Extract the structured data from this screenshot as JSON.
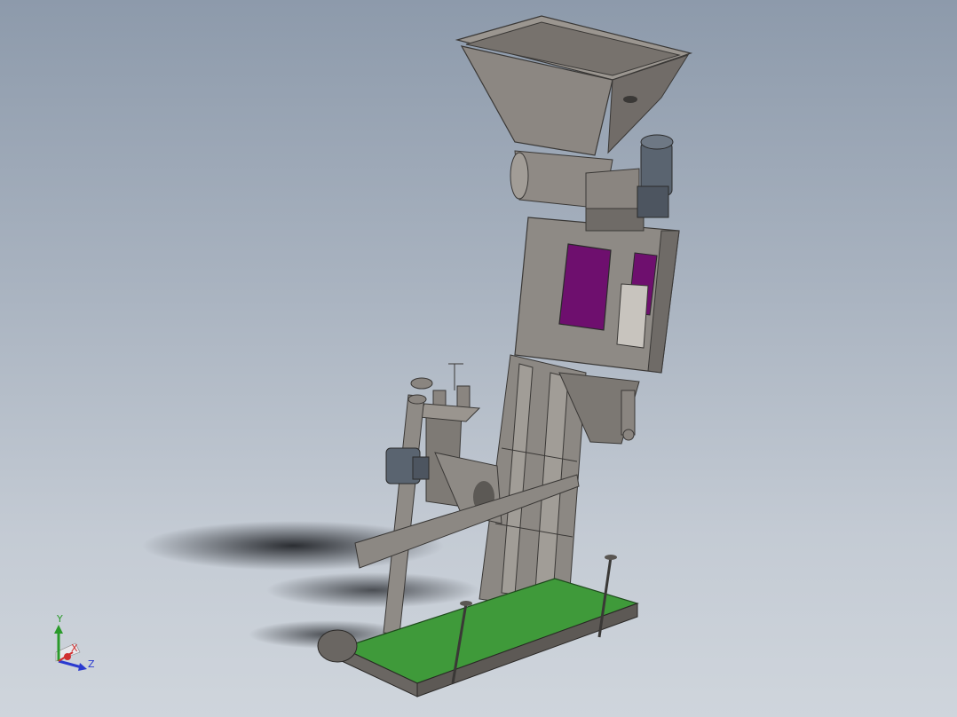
{
  "viewport": {
    "background_top": "#8d9aab",
    "background_bottom": "#cfd5dc"
  },
  "model": {
    "hopper_color": "#8a8580",
    "frame_color": "#8f8b86",
    "window_color": "#6e0f6e",
    "belt_color": "#3f9a3a",
    "motor_color": "#5a6470"
  },
  "triad": {
    "x_label": "X",
    "y_label": "Y",
    "z_label": "Z",
    "x_color": "#d03030",
    "y_color": "#2a9a2a",
    "z_color": "#2a3ad0"
  }
}
